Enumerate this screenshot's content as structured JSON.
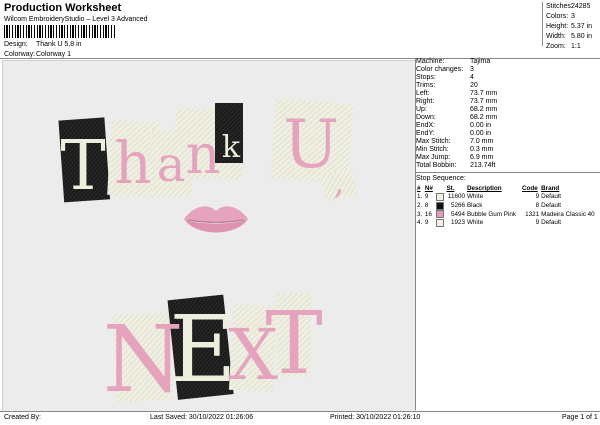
{
  "header": {
    "title": "Production Worksheet",
    "subtitle": "Wilcom EmbroideryStudio – Level 3 Advanced",
    "design_label": "Design:",
    "design_value": "Thank U 5,8 in",
    "colorway_label": "Colorway:",
    "colorway_value": "Colorway 1"
  },
  "stats": [
    {
      "label": "Stitches:",
      "value": "24285"
    },
    {
      "label": "Colors:",
      "value": "3"
    },
    {
      "label": "Height:",
      "value": "5.37 in"
    },
    {
      "label": "Width:",
      "value": "5.80 in"
    },
    {
      "label": "Zoom:",
      "value": "1:1"
    }
  ],
  "info": [
    {
      "label": "Machine:",
      "value": "Tajima"
    },
    {
      "label": "Color changes:",
      "value": "3"
    },
    {
      "label": "Stops:",
      "value": "4"
    },
    {
      "label": "Trims:",
      "value": "20"
    },
    {
      "label": "Left:",
      "value": "73.7 mm"
    },
    {
      "label": "Right:",
      "value": "73.7 mm"
    },
    {
      "label": "Up:",
      "value": "68.2 mm"
    },
    {
      "label": "Down:",
      "value": "68.2 mm"
    },
    {
      "label": "EndX:",
      "value": "0.00 in"
    },
    {
      "label": "EndY:",
      "value": "0.00 in"
    },
    {
      "label": "Max Stitch:",
      "value": "7.0 mm"
    },
    {
      "label": "Min Stitch:",
      "value": "0.3 mm"
    },
    {
      "label": "Max Jump:",
      "value": "6.9 mm"
    },
    {
      "label": "Total Bobbin:",
      "value": "213.74ft"
    }
  ],
  "sequence": {
    "title": "Stop Sequence:",
    "headers": [
      "#",
      "N#",
      "",
      "St.",
      "Description",
      "Code",
      "Brand"
    ],
    "rows": [
      {
        "num": "1.",
        "n": "9",
        "color": "#f2f2e6",
        "st": "11600",
        "desc": "White",
        "code": "9",
        "brand": "Default"
      },
      {
        "num": "2.",
        "n": "8",
        "color": "#111111",
        "st": "5266",
        "desc": "Black",
        "code": "8",
        "brand": "Default"
      },
      {
        "num": "3.",
        "n": "16",
        "color": "#e79ab8",
        "st": "5494",
        "desc": "Bubble Gum Pink",
        "code": "1321",
        "brand": "Madeira Classic 40"
      },
      {
        "num": "4.",
        "n": "9",
        "color": "#f2f2e6",
        "st": "1923",
        "desc": "White",
        "code": "9",
        "brand": "Default"
      }
    ]
  },
  "design": {
    "line1": [
      "T",
      "h",
      "a",
      "n",
      "k",
      "U",
      ","
    ],
    "line2": [
      "N",
      "E",
      "X",
      "T"
    ],
    "colors": {
      "cream": "#eeeedd",
      "black": "#1a1a1a",
      "pink": "#e5a3bd",
      "pink_dark": "#cf7f9f"
    }
  },
  "footer": {
    "created": "Created By:",
    "saved": "Last Saved: 30/10/2022 01:26:06",
    "printed": "Printed: 30/10/2022 01:26:10",
    "page": "Page 1 of 1"
  }
}
